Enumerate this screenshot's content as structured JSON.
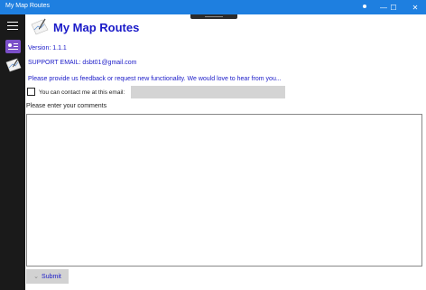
{
  "window": {
    "title": "My Map Routes",
    "minimize_glyph": "—",
    "maximize_glyph": "☐",
    "close_glyph": "✕",
    "accent_color": "#1e7fe0"
  },
  "sidebar": {
    "menu_icon": "hamburger-icon",
    "items": [
      {
        "icon": "contact-card-icon",
        "color": "#7b4fc8"
      },
      {
        "icon": "map-icon"
      }
    ]
  },
  "header": {
    "logo_icon": "map-logo-icon",
    "title": "My Map Routes",
    "title_color": "#1a1ac8"
  },
  "info": {
    "version": "Version: 1.1.1",
    "support_email": "SUPPORT EMAIL: dsbt01@gmail.com"
  },
  "feedback": {
    "prompt": "Please provide us feedback or request new functionality.  We would love to hear from you...",
    "contact_checkbox_checked": false,
    "contact_label": "You can contact me at this email:",
    "email_value": "",
    "comments_label": "Please enter your comments",
    "comments_value": "",
    "submit_label": "Submit",
    "submit_icon": "chevron-down-icon"
  }
}
